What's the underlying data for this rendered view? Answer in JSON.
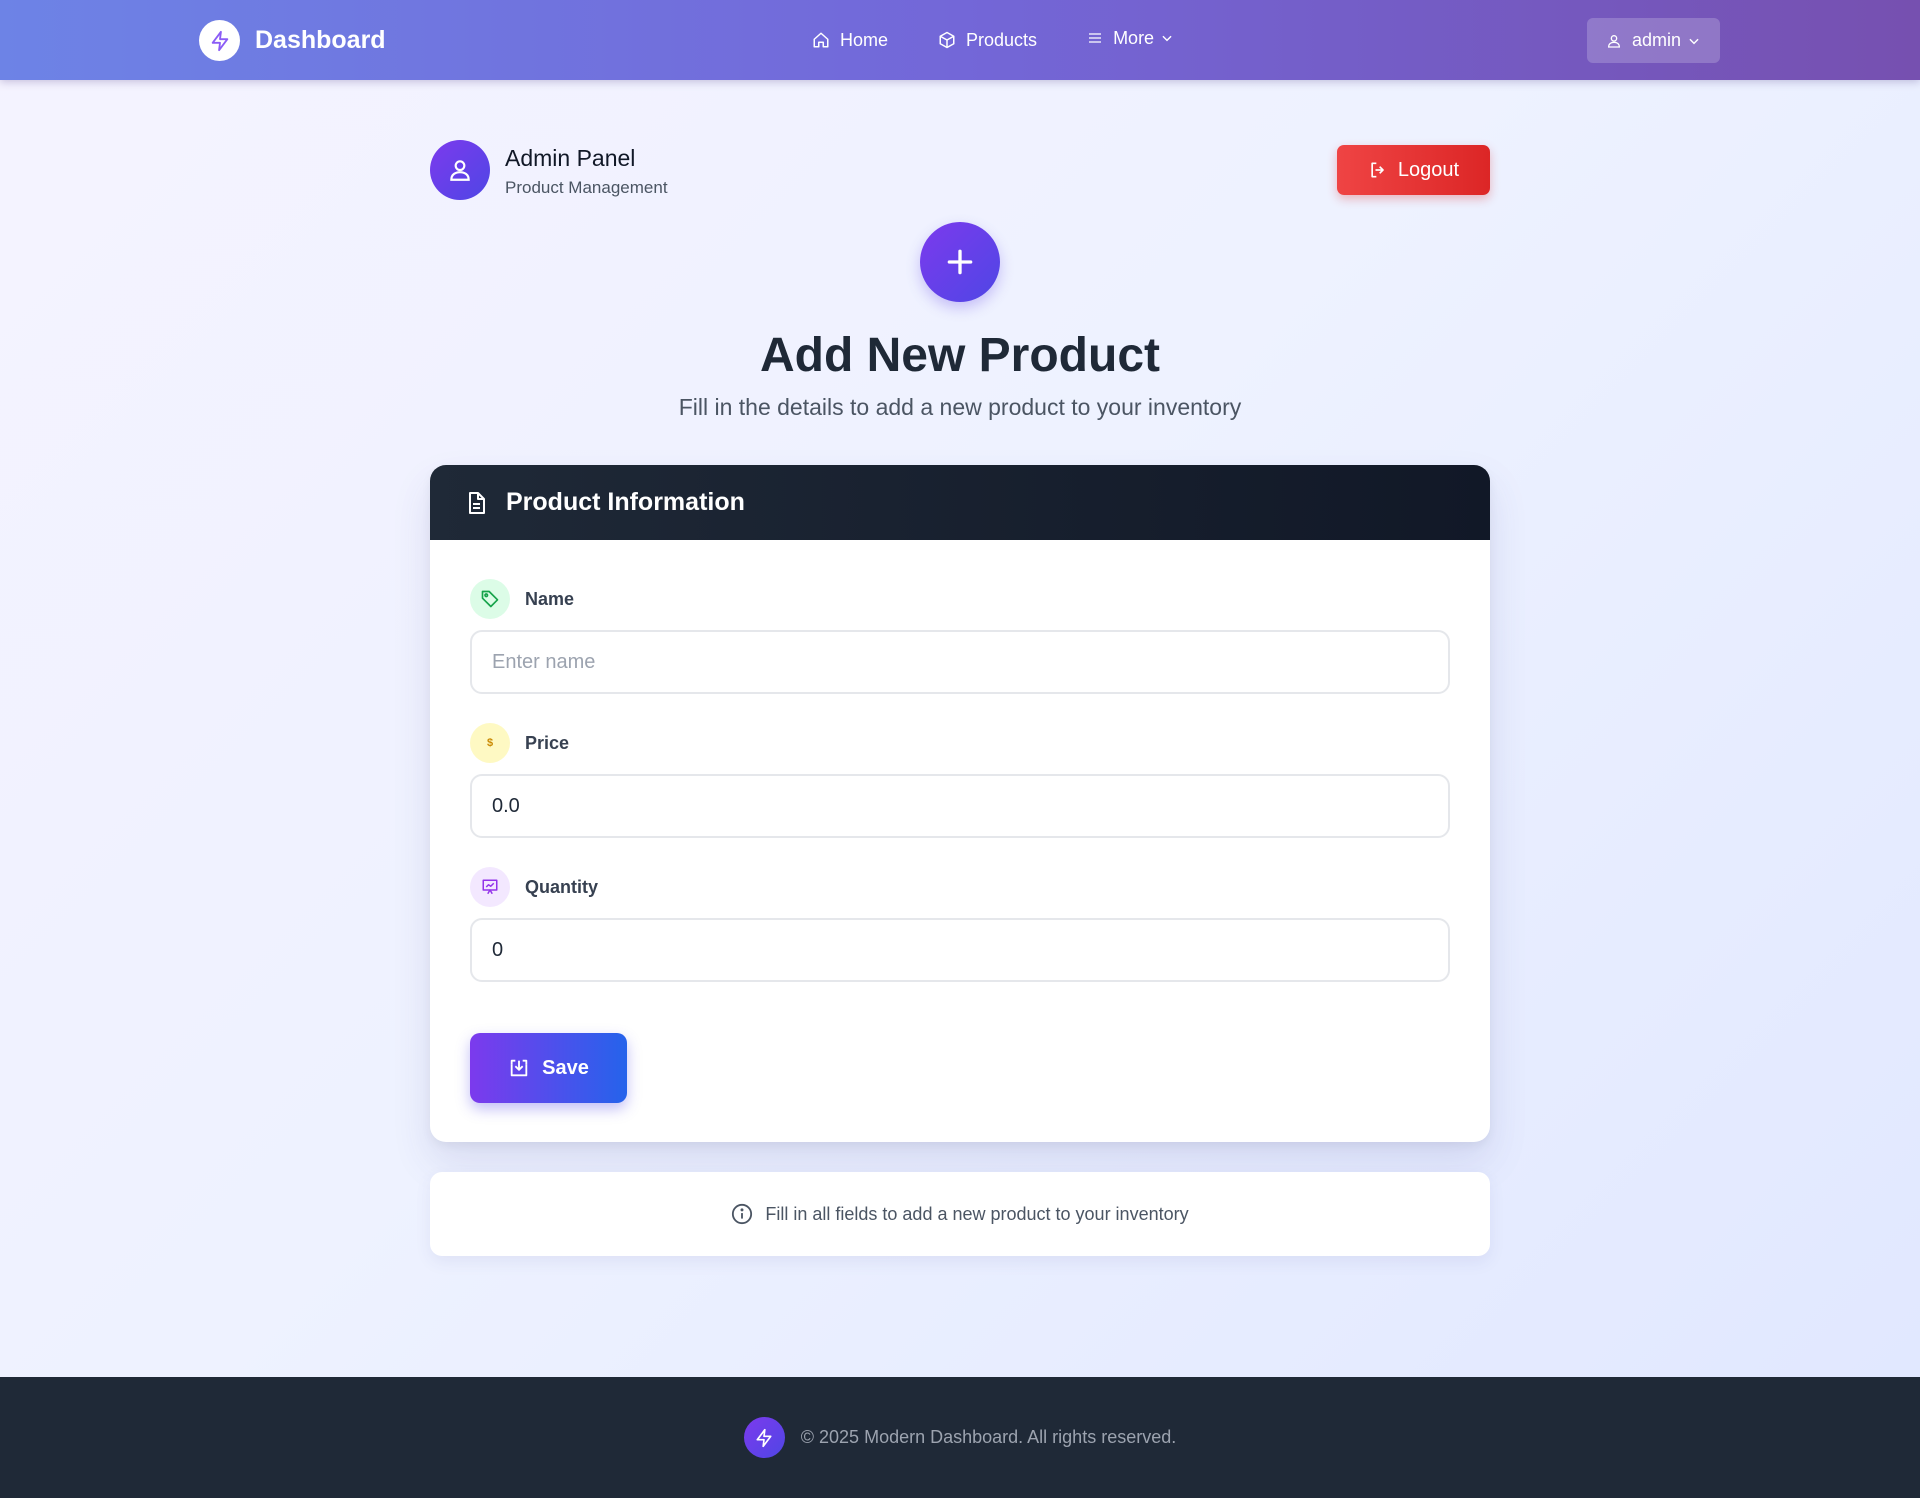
{
  "navbar": {
    "brand": "Dashboard",
    "links": [
      {
        "label": "Home",
        "icon": "home-icon"
      },
      {
        "label": "Products",
        "icon": "box-icon"
      },
      {
        "label": "More",
        "icon": "menu-icon"
      }
    ],
    "user": "admin"
  },
  "header": {
    "title": "Admin Panel",
    "subtitle": "Product Management",
    "logout_label": "Logout"
  },
  "page": {
    "title": "Add New Product",
    "subtitle": "Fill in the details to add a new product to your inventory"
  },
  "form": {
    "card_title": "Product Information",
    "fields": [
      {
        "label": "Name",
        "placeholder": "Enter name",
        "value": "",
        "icon": "tag-icon",
        "icon_bg": "#dcfce7",
        "icon_color": "#16a34a"
      },
      {
        "label": "Price",
        "placeholder": "",
        "value": "0.0",
        "icon": "dollar-icon",
        "icon_bg": "#fef9c3",
        "icon_color": "#ca8a04"
      },
      {
        "label": "Quantity",
        "placeholder": "",
        "value": "0",
        "icon": "chart-board-icon",
        "icon_bg": "#f3e8ff",
        "icon_color": "#9333ea"
      }
    ],
    "save_label": "Save"
  },
  "info": {
    "text": "Fill in all fields to add a new product to your inventory"
  },
  "footer": {
    "text": "© 2025 Modern Dashboard. All rights reserved."
  },
  "colors": {
    "accent": "#7c3aed",
    "danger": "#ef4444",
    "dark": "#1f2937"
  }
}
